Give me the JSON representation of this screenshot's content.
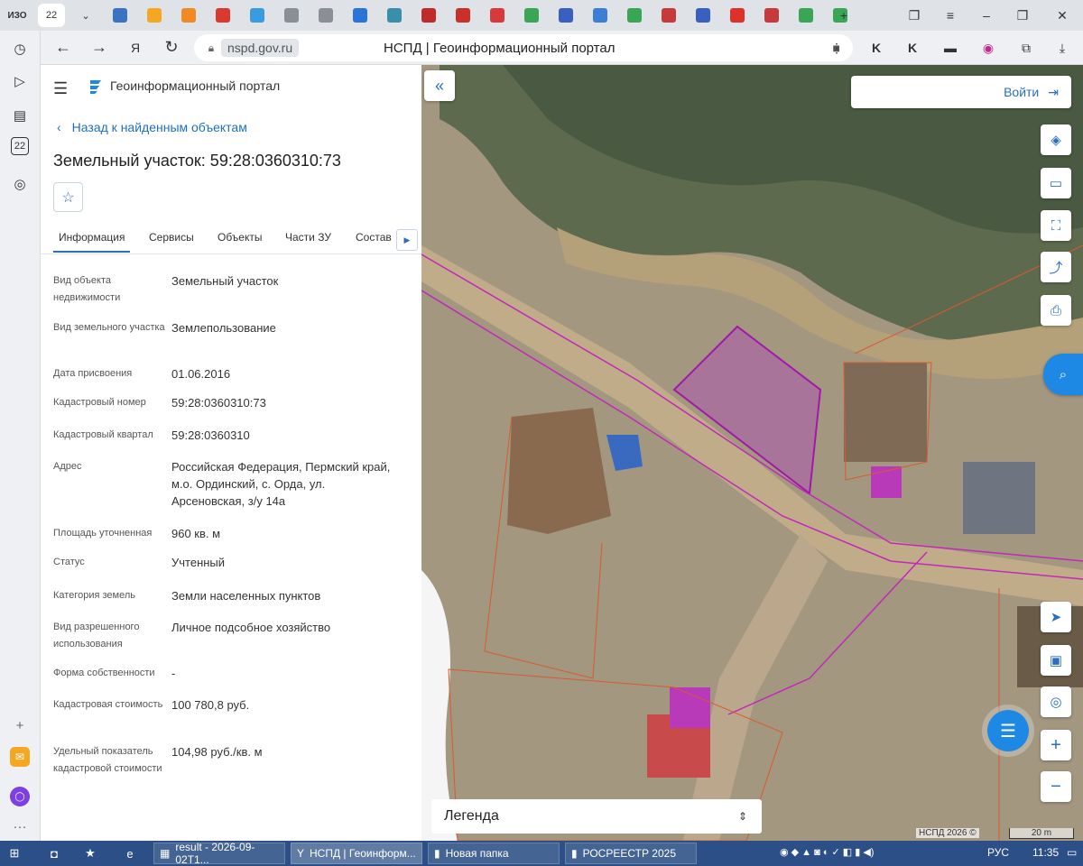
{
  "browser": {
    "first_tab_label": "ИЗО",
    "second_tab_label": "22",
    "tab_colors": [
      "#3a73c2",
      "#f5a623",
      "#f08a24",
      "#d93a2b",
      "#3a9be0",
      "#8a8f96",
      "#8a8f96",
      "#2a73d8",
      "#3a8fa8",
      "#c02a2a",
      "#c9302c",
      "#d83a3a",
      "#3aa655",
      "#3a5fbf",
      "#3a7fd5",
      "#3aa655",
      "#c63a3a",
      "#3a5fbf",
      "#e0302c",
      "#c63a3a",
      "#3aa655",
      "#3aa655"
    ],
    "side_badge": "22",
    "url_host": "nspd.gov.ru",
    "page_title": "НСПД | Геоинформационный портал"
  },
  "portal": {
    "brand": "Геоинформационный портал",
    "back_link": "Назад к найденным объектам",
    "object_title": "Земельный участок: 59:28:0360310:73",
    "tabs": [
      "Информация",
      "Сервисы",
      "Объекты",
      "Части ЗУ",
      "Состав"
    ],
    "fields": [
      {
        "label": "Вид объекта недвижимости",
        "value": "Земельный участок"
      },
      {
        "label": "Вид земельного участка",
        "value": "Землепользование"
      },
      {
        "label": "Дата присвоения",
        "value": "01.06.2016"
      },
      {
        "label": "Кадастровый номер",
        "value": "59:28:0360310:73"
      },
      {
        "label": "Кадастровый квартал",
        "value": "59:28:0360310"
      },
      {
        "label": "Адрес",
        "value": "Российская Федерация, Пермский край, м.о. Ординский, с. Орда, ул. Арсеновская, з/у 14а"
      },
      {
        "label": "Площадь уточненная",
        "value": "960 кв. м"
      },
      {
        "label": "Статус",
        "value": "Учтенный"
      },
      {
        "label": "Категория земель",
        "value": "Земли населенных пунктов"
      },
      {
        "label": "Вид разрешенного использования",
        "value": "Личное подсобное хозяйство"
      },
      {
        "label": "Форма собственности",
        "value": "-"
      },
      {
        "label": "Кадастровая стоимость",
        "value": "100 780,8 руб."
      },
      {
        "label": "Удельный показатель кадастровой стоимости",
        "value": "104,98 руб./кв. м"
      }
    ]
  },
  "map": {
    "login_label": "Войти",
    "legend_label": "Легенда",
    "attribution": "НСПД 2026 ©",
    "scale_label": "20 m"
  },
  "taskbar": {
    "items": [
      "result - 2026-09-02T1...",
      "НСПД | Геоинформ...",
      "Новая папка",
      "РОСРЕЕСТР 2025"
    ],
    "language": "РУС",
    "time": "11:35"
  }
}
